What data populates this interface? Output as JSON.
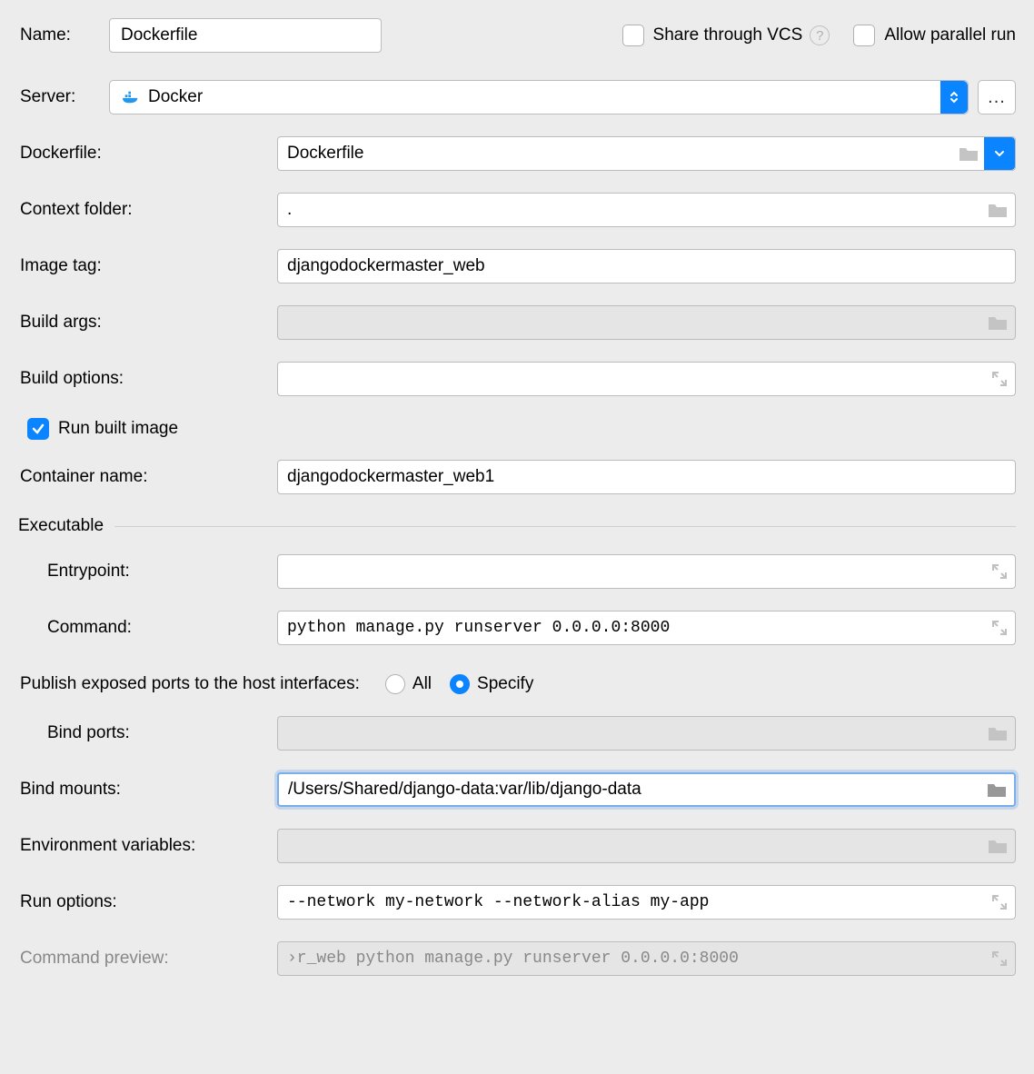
{
  "top": {
    "name_label": "Name:",
    "name_value": "Dockerfile",
    "share_vcs_label": "Share through VCS",
    "allow_parallel_label": "Allow parallel run"
  },
  "server": {
    "label": "Server:",
    "value": "Docker"
  },
  "fields": {
    "dockerfile_label": "Dockerfile:",
    "dockerfile_value": "Dockerfile",
    "context_label": "Context folder:",
    "context_value": ".",
    "image_tag_label": "Image tag:",
    "image_tag_value": "djangodockermaster_web",
    "build_args_label": "Build args:",
    "build_args_value": "",
    "build_options_label": "Build options:",
    "build_options_value": "",
    "run_built_label": "Run built image",
    "container_name_label": "Container name:",
    "container_name_value": "djangodockermaster_web1"
  },
  "executable": {
    "section_label": "Executable",
    "entrypoint_label": "Entrypoint:",
    "entrypoint_value": "",
    "command_label": "Command:",
    "command_value": "python manage.py runserver 0.0.0.0:8000"
  },
  "ports": {
    "label": "Publish exposed ports to the host interfaces:",
    "all_label": "All",
    "specify_label": "Specify",
    "bind_ports_label": "Bind ports:",
    "bind_ports_value": ""
  },
  "more": {
    "bind_mounts_label": "Bind mounts:",
    "bind_mounts_value": "/Users/Shared/django-data:var/lib/django-data",
    "env_label": "Environment variables:",
    "env_value": "",
    "run_options_label": "Run options:",
    "run_options_value": "--network my-network --network-alias my-app",
    "preview_label": "Command preview:",
    "preview_value": "›r_web python manage.py runserver 0.0.0.0:8000"
  }
}
